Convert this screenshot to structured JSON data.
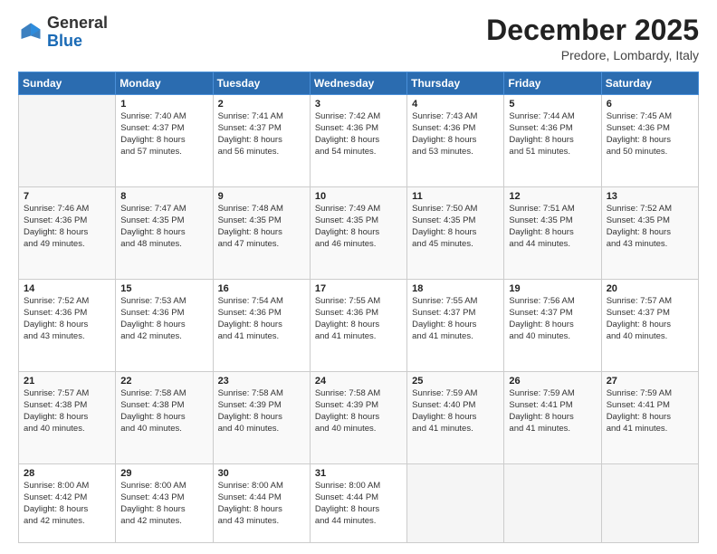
{
  "header": {
    "logo_general": "General",
    "logo_blue": "Blue",
    "month_title": "December 2025",
    "location": "Predore, Lombardy, Italy"
  },
  "days_of_week": [
    "Sunday",
    "Monday",
    "Tuesday",
    "Wednesday",
    "Thursday",
    "Friday",
    "Saturday"
  ],
  "weeks": [
    [
      {
        "day": "",
        "content": ""
      },
      {
        "day": "1",
        "content": "Sunrise: 7:40 AM\nSunset: 4:37 PM\nDaylight: 8 hours\nand 57 minutes."
      },
      {
        "day": "2",
        "content": "Sunrise: 7:41 AM\nSunset: 4:37 PM\nDaylight: 8 hours\nand 56 minutes."
      },
      {
        "day": "3",
        "content": "Sunrise: 7:42 AM\nSunset: 4:36 PM\nDaylight: 8 hours\nand 54 minutes."
      },
      {
        "day": "4",
        "content": "Sunrise: 7:43 AM\nSunset: 4:36 PM\nDaylight: 8 hours\nand 53 minutes."
      },
      {
        "day": "5",
        "content": "Sunrise: 7:44 AM\nSunset: 4:36 PM\nDaylight: 8 hours\nand 51 minutes."
      },
      {
        "day": "6",
        "content": "Sunrise: 7:45 AM\nSunset: 4:36 PM\nDaylight: 8 hours\nand 50 minutes."
      }
    ],
    [
      {
        "day": "7",
        "content": "Sunrise: 7:46 AM\nSunset: 4:36 PM\nDaylight: 8 hours\nand 49 minutes."
      },
      {
        "day": "8",
        "content": "Sunrise: 7:47 AM\nSunset: 4:35 PM\nDaylight: 8 hours\nand 48 minutes."
      },
      {
        "day": "9",
        "content": "Sunrise: 7:48 AM\nSunset: 4:35 PM\nDaylight: 8 hours\nand 47 minutes."
      },
      {
        "day": "10",
        "content": "Sunrise: 7:49 AM\nSunset: 4:35 PM\nDaylight: 8 hours\nand 46 minutes."
      },
      {
        "day": "11",
        "content": "Sunrise: 7:50 AM\nSunset: 4:35 PM\nDaylight: 8 hours\nand 45 minutes."
      },
      {
        "day": "12",
        "content": "Sunrise: 7:51 AM\nSunset: 4:35 PM\nDaylight: 8 hours\nand 44 minutes."
      },
      {
        "day": "13",
        "content": "Sunrise: 7:52 AM\nSunset: 4:35 PM\nDaylight: 8 hours\nand 43 minutes."
      }
    ],
    [
      {
        "day": "14",
        "content": "Sunrise: 7:52 AM\nSunset: 4:36 PM\nDaylight: 8 hours\nand 43 minutes."
      },
      {
        "day": "15",
        "content": "Sunrise: 7:53 AM\nSunset: 4:36 PM\nDaylight: 8 hours\nand 42 minutes."
      },
      {
        "day": "16",
        "content": "Sunrise: 7:54 AM\nSunset: 4:36 PM\nDaylight: 8 hours\nand 41 minutes."
      },
      {
        "day": "17",
        "content": "Sunrise: 7:55 AM\nSunset: 4:36 PM\nDaylight: 8 hours\nand 41 minutes."
      },
      {
        "day": "18",
        "content": "Sunrise: 7:55 AM\nSunset: 4:37 PM\nDaylight: 8 hours\nand 41 minutes."
      },
      {
        "day": "19",
        "content": "Sunrise: 7:56 AM\nSunset: 4:37 PM\nDaylight: 8 hours\nand 40 minutes."
      },
      {
        "day": "20",
        "content": "Sunrise: 7:57 AM\nSunset: 4:37 PM\nDaylight: 8 hours\nand 40 minutes."
      }
    ],
    [
      {
        "day": "21",
        "content": "Sunrise: 7:57 AM\nSunset: 4:38 PM\nDaylight: 8 hours\nand 40 minutes."
      },
      {
        "day": "22",
        "content": "Sunrise: 7:58 AM\nSunset: 4:38 PM\nDaylight: 8 hours\nand 40 minutes."
      },
      {
        "day": "23",
        "content": "Sunrise: 7:58 AM\nSunset: 4:39 PM\nDaylight: 8 hours\nand 40 minutes."
      },
      {
        "day": "24",
        "content": "Sunrise: 7:58 AM\nSunset: 4:39 PM\nDaylight: 8 hours\nand 40 minutes."
      },
      {
        "day": "25",
        "content": "Sunrise: 7:59 AM\nSunset: 4:40 PM\nDaylight: 8 hours\nand 41 minutes."
      },
      {
        "day": "26",
        "content": "Sunrise: 7:59 AM\nSunset: 4:41 PM\nDaylight: 8 hours\nand 41 minutes."
      },
      {
        "day": "27",
        "content": "Sunrise: 7:59 AM\nSunset: 4:41 PM\nDaylight: 8 hours\nand 41 minutes."
      }
    ],
    [
      {
        "day": "28",
        "content": "Sunrise: 8:00 AM\nSunset: 4:42 PM\nDaylight: 8 hours\nand 42 minutes."
      },
      {
        "day": "29",
        "content": "Sunrise: 8:00 AM\nSunset: 4:43 PM\nDaylight: 8 hours\nand 42 minutes."
      },
      {
        "day": "30",
        "content": "Sunrise: 8:00 AM\nSunset: 4:44 PM\nDaylight: 8 hours\nand 43 minutes."
      },
      {
        "day": "31",
        "content": "Sunrise: 8:00 AM\nSunset: 4:44 PM\nDaylight: 8 hours\nand 44 minutes."
      },
      {
        "day": "",
        "content": ""
      },
      {
        "day": "",
        "content": ""
      },
      {
        "day": "",
        "content": ""
      }
    ]
  ]
}
